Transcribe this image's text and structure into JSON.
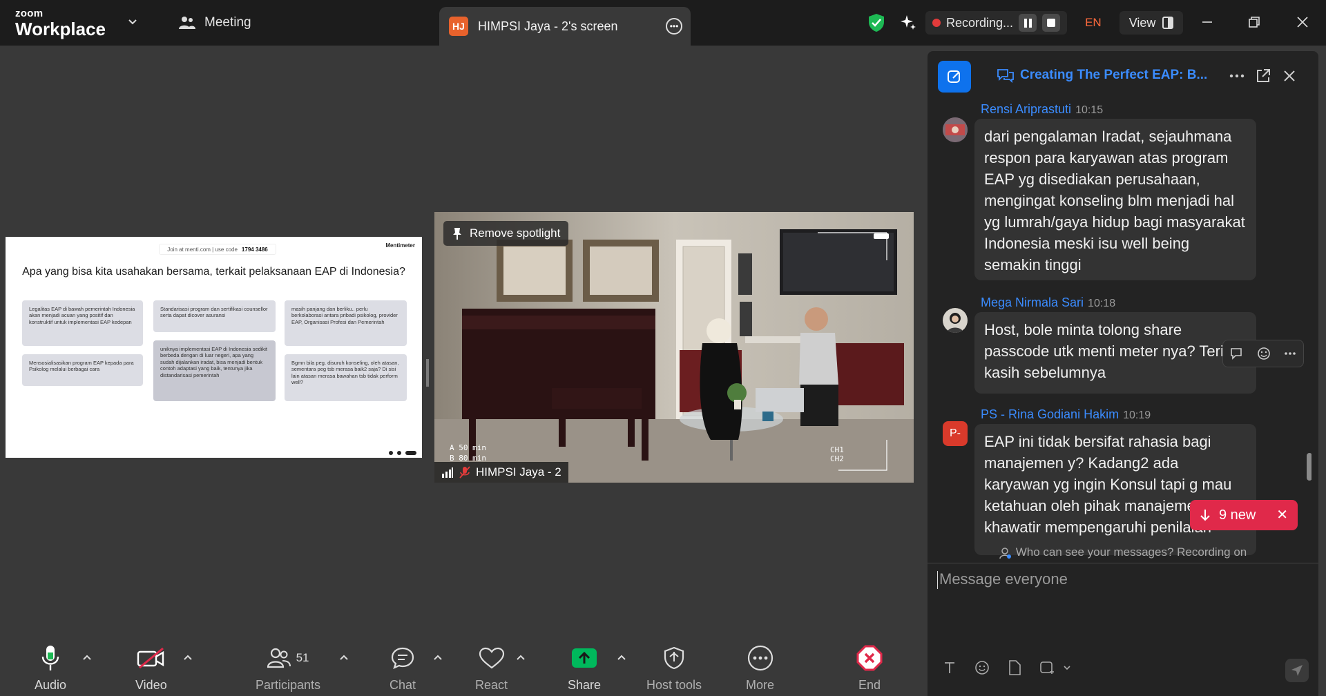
{
  "app": {
    "brand_small": "zoom",
    "brand_big": "Workplace"
  },
  "topbar": {
    "meeting_label": "Meeting",
    "share_tab": {
      "initials": "HJ",
      "title": "HIMPSI Jaya - 2's screen"
    },
    "recording_label": "Recording...",
    "language": "EN",
    "view_label": "View"
  },
  "slide": {
    "join_text": "Join at menti.com | use code",
    "join_code": "1794 3486",
    "brand": "Mentimeter",
    "question": "Apa yang bisa kita usahakan bersama, terkait pelaksanaan EAP di Indonesia?",
    "notes": [
      "Legalitas EAP di bawah pemerintah Indonesia akan menjadi acuan yang positif dan konstruktif untuk implementasi EAP kedepan",
      "Standarisasi program dan sertifikasi counsellor serta dapat dicover asuransi",
      "masih panjang dan berliku.. perlu berkolaborasi antara pribadi psikolog, provider EAP, Organisasi Profesi dan Pemerintah",
      "Mensosialisasikan program EAP kepada para Psikolog melalui berbagai cara",
      "uniknya implementasi EAP di Indonesia sedikit berbeda dengan di luar negeri, apa yang sudah dijalankan iradat, bisa menjadi bentuk contoh adaptasi yang baik, tentunya jika distandarisasi pemerintah",
      "Bgmn bila peg. disuruh konseling, oleh atasan, sementara peg tsb merasa baik2 saja? Di sisi lain atasan merasa bawahan tsb tidak perform well?"
    ]
  },
  "video": {
    "spotlight_label": "Remove spotlight",
    "participant_name": "HIMPSI Jaya - 2",
    "overlay_a": "A  50 min",
    "overlay_b": "B  80 min",
    "ch1": "CH1",
    "ch2": "CH2"
  },
  "chat": {
    "title": "Creating The Perfect EAP: B...",
    "messages": [
      {
        "sender": "Rensi Ariprastuti",
        "time": "10:15",
        "text": "dari pengalaman Iradat, sejauhmana respon para karyawan atas program EAP yg disediakan perusahaan, mengingat konseling blm menjadi hal yg lumrah/gaya hidup bagi masyarakat Indonesia meski isu well being semakin tinggi"
      },
      {
        "sender": "Mega Nirmala Sari",
        "time": "10:18",
        "text": "Host, bole minta tolong share passcode utk menti meter nya? Terima kasih sebelumnya"
      },
      {
        "sender": "PS - Rina Godiani Hakim",
        "time": "10:19",
        "initials": "P-",
        "text": "EAP ini tidak bersifat rahasia bagi manajemen y? Kadang2 ada karyawan yg ingin Konsul tapi g mau ketahuan oleh pihak manajemen khawatir mempengaruhi penilaian"
      }
    ],
    "new_badge": "9 new",
    "visibility_note": "Who can see your messages? Recording on",
    "input_placeholder": "Message everyone"
  },
  "toolbar": {
    "audio": "Audio",
    "video": "Video",
    "participants": "Participants",
    "participants_count": "51",
    "chat": "Chat",
    "react": "React",
    "share": "Share",
    "host_tools": "Host tools",
    "more": "More",
    "end": "End"
  },
  "colors": {
    "accent": "#0e72ed",
    "share_green": "#00b85c",
    "end_red": "#e0294a",
    "link_blue": "#3b8cff"
  }
}
